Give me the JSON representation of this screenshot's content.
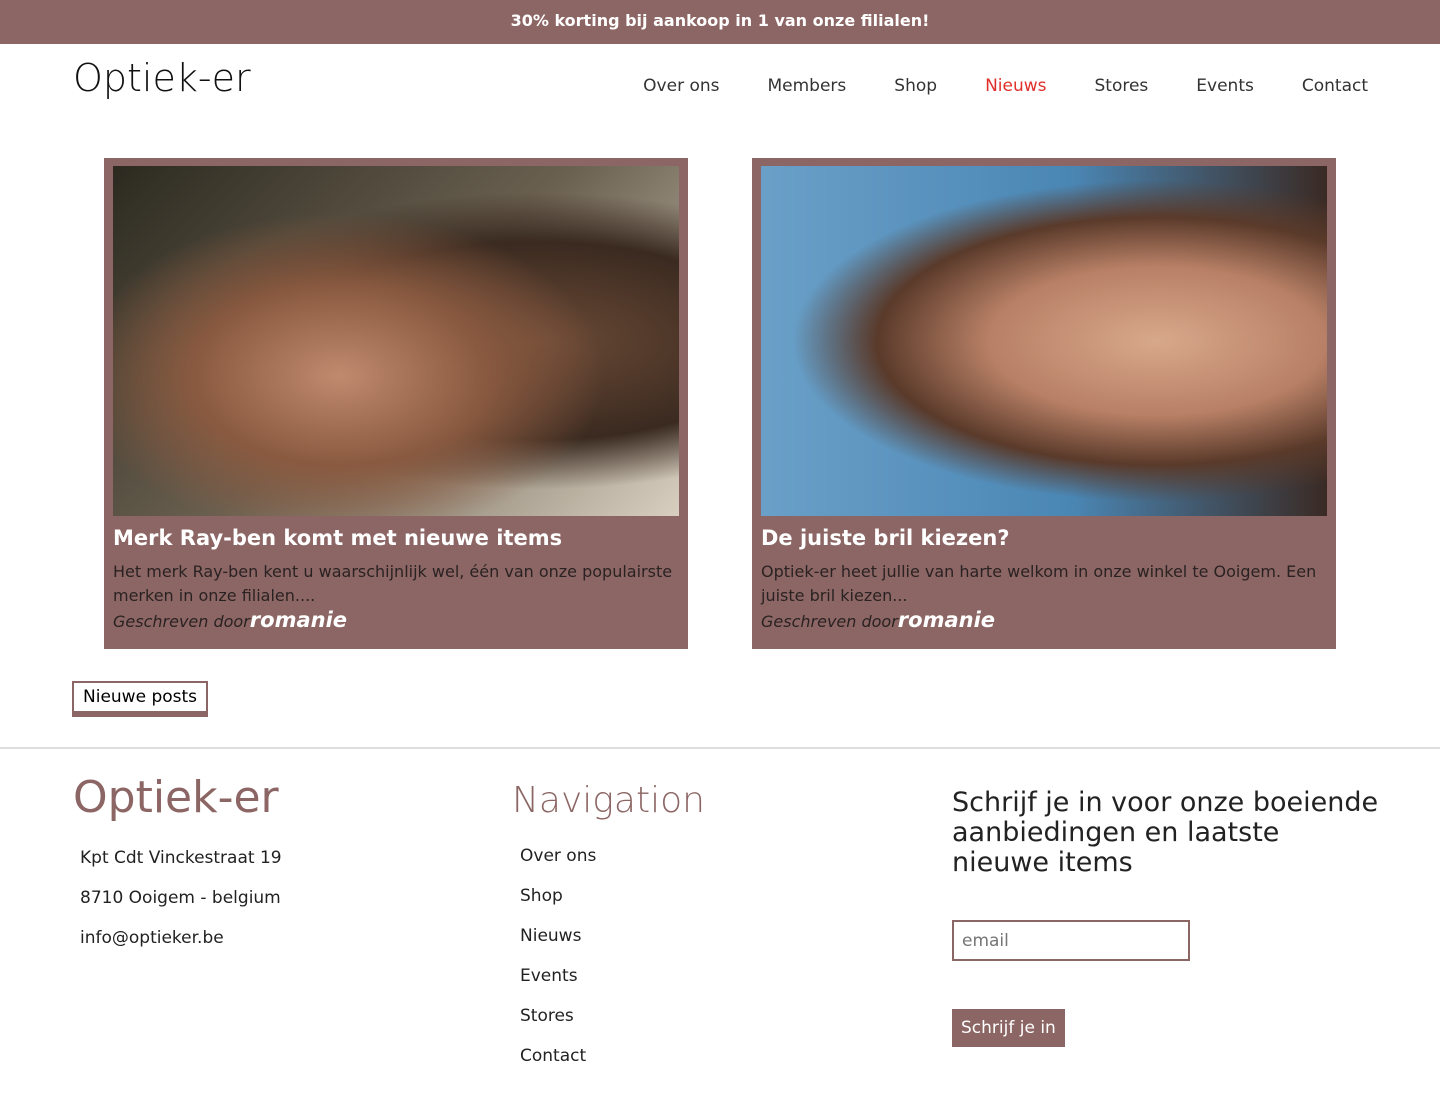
{
  "promo": "30% korting bij aankoop in 1 van onze filialen!",
  "logo": "Optiek-er",
  "nav": [
    "Over ons",
    "Members",
    "Shop",
    "Nieuws",
    "Stores",
    "Events",
    "Contact"
  ],
  "posts": [
    {
      "title": "Merk Ray-ben komt met nieuwe items",
      "excerpt": "Het merk Ray-ben kent u waarschijnlijk wel, één van onze populairste merken in onze filialen....",
      "by": "Geschreven door",
      "author": "romanie"
    },
    {
      "title": "De juiste bril kiezen?",
      "excerpt": "Optiek-er heet jullie van harte welkom in onze winkel te Ooigem. Een juiste bril kiezen...",
      "by": "Geschreven door",
      "author": "romanie"
    }
  ],
  "more": "Nieuwe posts",
  "footer": {
    "logo": "Optiek-er",
    "address": [
      "Kpt Cdt Vinckestraat 19",
      "8710 Ooigem - belgium",
      "info@optieker.be"
    ],
    "nav_title": "Navigation",
    "nav": [
      "Over ons",
      "Shop",
      "Nieuws",
      "Events",
      "Stores",
      "Contact"
    ],
    "subscribe_title": "Schrijf je in voor onze boeiende aanbiedingen en laatste nieuwe items",
    "email_placeholder": "email",
    "subscribe_button": "Schrijf je in"
  }
}
